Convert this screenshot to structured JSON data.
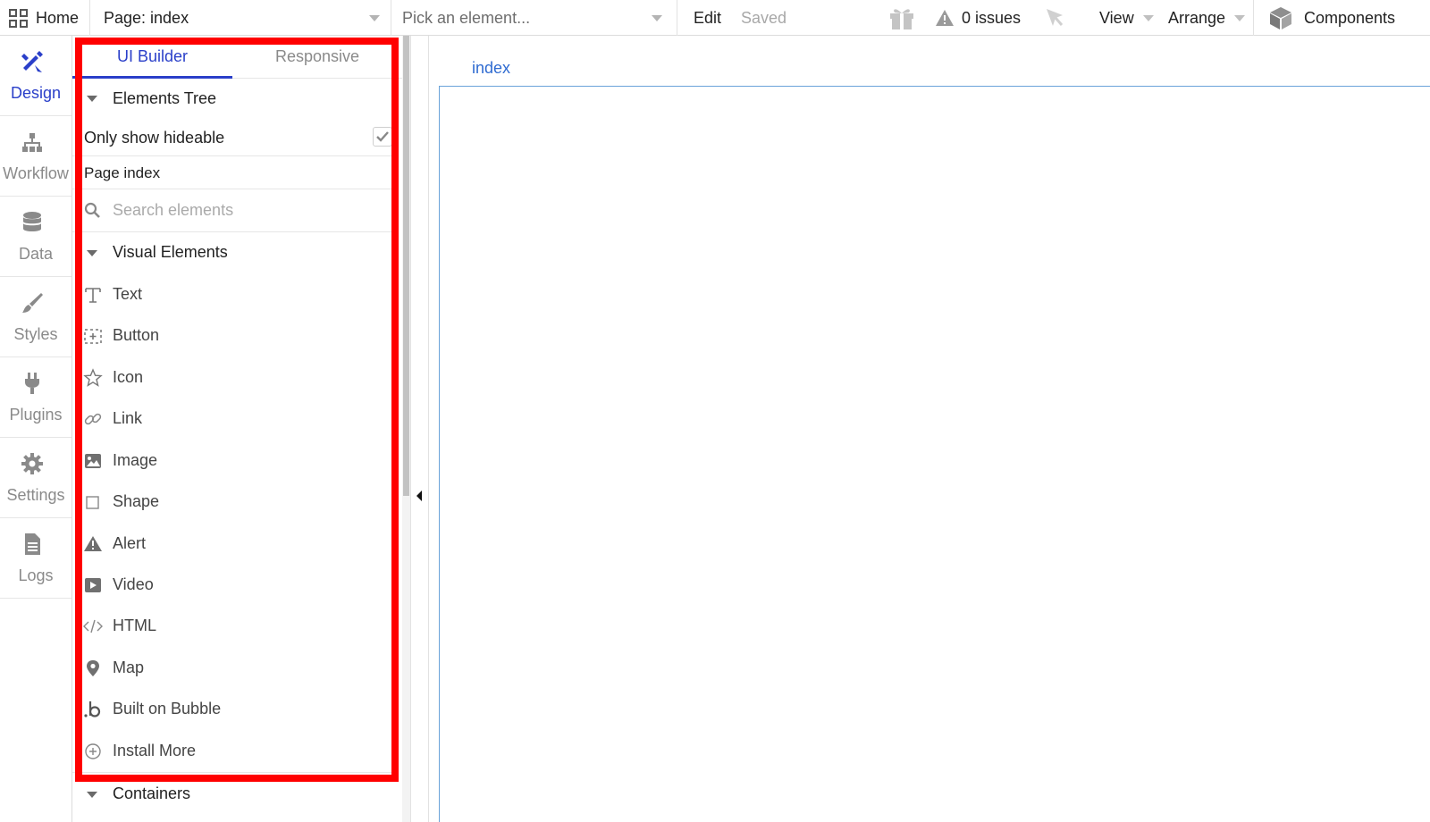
{
  "topbar": {
    "home_label": "Home",
    "page_label": "Page: index",
    "element_picker_placeholder": "Pick an element...",
    "edit_label": "Edit",
    "saved_label": "Saved",
    "issues_label": "0 issues",
    "view_label": "View",
    "arrange_label": "Arrange",
    "components_label": "Components"
  },
  "leftnav": {
    "items": [
      {
        "label": "Design",
        "icon": "design-icon",
        "active": true
      },
      {
        "label": "Workflow",
        "icon": "workflow-icon"
      },
      {
        "label": "Data",
        "icon": "database-icon"
      },
      {
        "label": "Styles",
        "icon": "brush-icon"
      },
      {
        "label": "Plugins",
        "icon": "plug-icon"
      },
      {
        "label": "Settings",
        "icon": "gear-icon"
      },
      {
        "label": "Logs",
        "icon": "document-icon"
      }
    ]
  },
  "palette": {
    "tabs": [
      "UI Builder",
      "Responsive"
    ],
    "elements_tree_label": "Elements Tree",
    "only_hideable_label": "Only show hideable",
    "page_index_label": "Page index",
    "search_placeholder": "Search elements",
    "visual_elements_label": "Visual Elements",
    "elements": [
      {
        "label": "Text",
        "icon": "text-icon"
      },
      {
        "label": "Button",
        "icon": "button-icon"
      },
      {
        "label": "Icon",
        "icon": "star-icon"
      },
      {
        "label": "Link",
        "icon": "link-icon"
      },
      {
        "label": "Image",
        "icon": "image-icon"
      },
      {
        "label": "Shape",
        "icon": "square-icon"
      },
      {
        "label": "Alert",
        "icon": "alert-icon"
      },
      {
        "label": "Video",
        "icon": "video-icon"
      },
      {
        "label": "HTML",
        "icon": "code-icon"
      },
      {
        "label": "Map",
        "icon": "map-pin-icon"
      },
      {
        "label": "Built on Bubble",
        "icon": "bubble-logo-icon"
      },
      {
        "label": "Install More",
        "icon": "plus-circle-icon"
      }
    ],
    "containers_label": "Containers"
  },
  "canvas": {
    "page_name": "index"
  },
  "colors": {
    "accent": "#2a3fc9",
    "highlight": "#ff0000",
    "canvas_border": "#6aa3d9",
    "canvas_label": "#2f6bd1"
  }
}
